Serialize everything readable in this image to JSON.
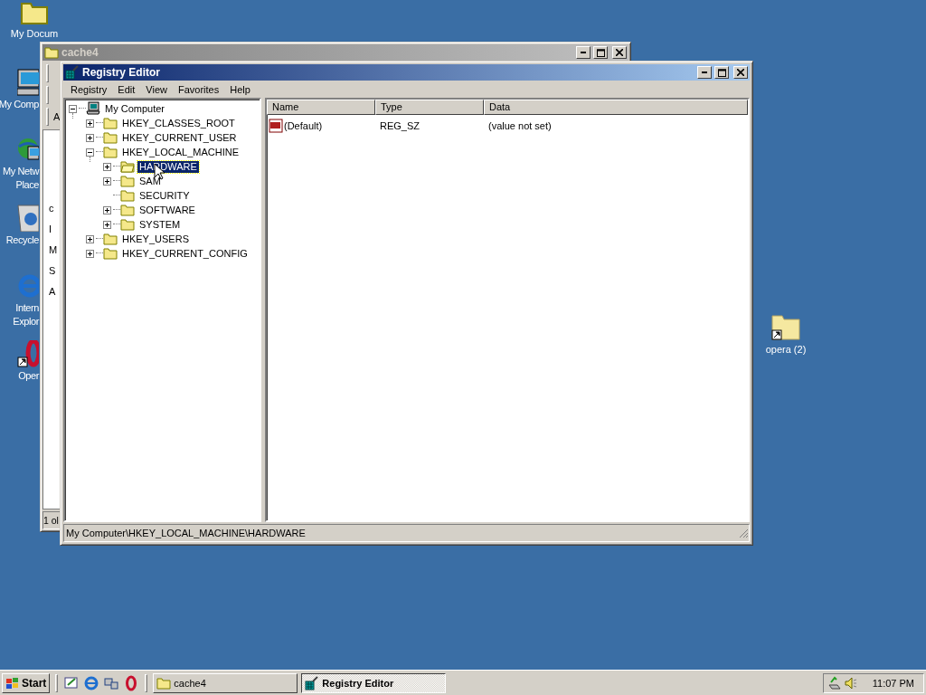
{
  "desktop_icons": [
    {
      "kind": "documents",
      "lines": [
        "My Docum"
      ]
    },
    {
      "kind": "computer",
      "lines": [
        "My Comp"
      ]
    },
    {
      "kind": "network",
      "lines": [
        "My Netw",
        "Place"
      ]
    },
    {
      "kind": "recycle",
      "lines": [
        "Recycle"
      ]
    },
    {
      "kind": "browser",
      "lines": [
        "Intern",
        "Explor"
      ]
    },
    {
      "kind": "opera",
      "lines": [
        "Oper"
      ]
    },
    {
      "kind": "folder-shortcut",
      "lines": [
        "opera (2)"
      ]
    }
  ],
  "back_window": {
    "title": "cache4",
    "active": false,
    "toolbar_letter": "A",
    "content_letters": [
      "c",
      "I",
      "M",
      "S",
      "A"
    ],
    "status": "1 ol"
  },
  "window": {
    "title": "Registry Editor",
    "active": true,
    "menu": [
      "Registry",
      "Edit",
      "View",
      "Favorites",
      "Help"
    ],
    "tree": [
      {
        "label": "My Computer",
        "kind": "computer",
        "expanded": true,
        "selected": false,
        "children": [
          {
            "label": "HKEY_CLASSES_ROOT",
            "kind": "branch",
            "expanded": false,
            "selected": false
          },
          {
            "label": "HKEY_CURRENT_USER",
            "kind": "branch",
            "expanded": false,
            "selected": false
          },
          {
            "label": "HKEY_LOCAL_MACHINE",
            "kind": "branch",
            "expanded": true,
            "selected": false,
            "children": [
              {
                "label": "HARDWARE",
                "kind": "branch",
                "expanded": false,
                "selected": true
              },
              {
                "label": "SAM",
                "kind": "branch",
                "expanded": false,
                "selected": false
              },
              {
                "label": "SECURITY",
                "kind": "leaf",
                "selected": false
              },
              {
                "label": "SOFTWARE",
                "kind": "branch",
                "expanded": false,
                "selected": false
              },
              {
                "label": "SYSTEM",
                "kind": "branch",
                "expanded": false,
                "selected": false
              }
            ]
          },
          {
            "label": "HKEY_USERS",
            "kind": "branch",
            "expanded": false,
            "selected": false
          },
          {
            "label": "HKEY_CURRENT_CONFIG",
            "kind": "branch",
            "expanded": false,
            "selected": false
          }
        ]
      }
    ],
    "columns": [
      "Name",
      "Type",
      "Data"
    ],
    "rows": [
      {
        "name": "(Default)",
        "type": "REG_SZ",
        "data": "(value not set)"
      }
    ],
    "status": "My Computer\\HKEY_LOCAL_MACHINE\\HARDWARE"
  },
  "taskbar": {
    "start": "Start",
    "tasks": [
      {
        "label": "cache4",
        "kind": "folder",
        "selected": false
      },
      {
        "label": "Registry Editor",
        "kind": "registry",
        "selected": true
      }
    ],
    "clock": "11:07 PM"
  }
}
